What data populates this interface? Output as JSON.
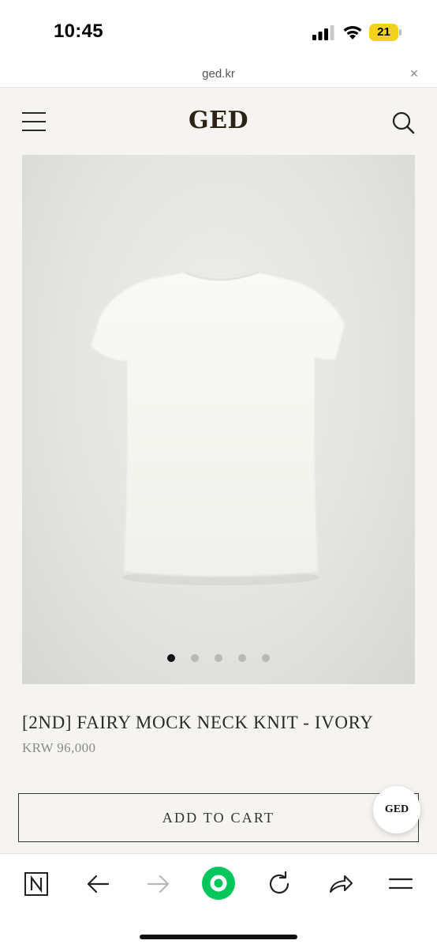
{
  "status_bar": {
    "time": "10:45",
    "battery": "21",
    "battery_color": "#f2d21c"
  },
  "url_bar": {
    "url": "ged.kr",
    "close_glyph": "×"
  },
  "header": {
    "logo": "GED",
    "menu_icon": "hamburger-menu-icon",
    "search_icon": "search-icon"
  },
  "gallery": {
    "image_count": 5,
    "active_index": 0,
    "subject": "ivory knit short-sleeve top"
  },
  "product": {
    "title": "[2ND] FAIRY MOCK NECK KNIT - IVORY",
    "price": "KRW 96,000",
    "add_to_cart_label": "ADD TO CART"
  },
  "floating_badge": {
    "label": "GED"
  },
  "browser_toolbar": {
    "items": [
      "naver-n-icon",
      "back-arrow-icon",
      "forward-arrow-icon",
      "green-home-icon",
      "reload-icon",
      "share-icon",
      "menu-icon"
    ],
    "accent_color": "#03c75a"
  }
}
